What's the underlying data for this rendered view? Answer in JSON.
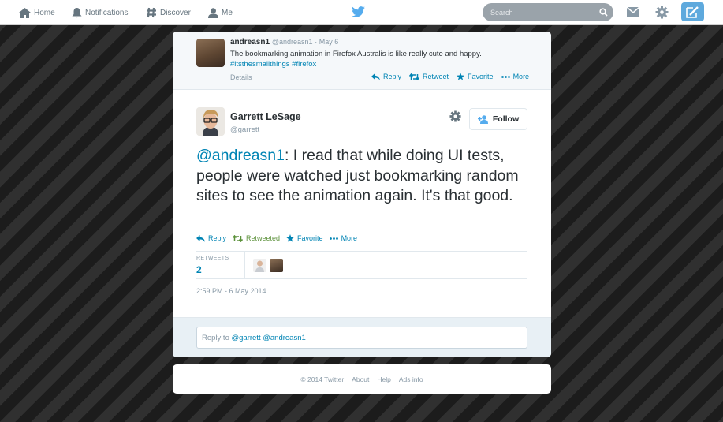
{
  "nav": {
    "home": "Home",
    "notifications": "Notifications",
    "discover": "Discover",
    "me": "Me",
    "search_placeholder": "Search"
  },
  "colors": {
    "link": "#0084b4",
    "twitter_blue": "#55acee",
    "retweeted": "#5c913b",
    "text_muted": "#8899a6"
  },
  "ancestor_tweet": {
    "name": "andreasn1",
    "handle": "@andreasn1",
    "date": "· May 6",
    "text": "The bookmarking animation in Firefox Australis is like really cute and happy.",
    "hashtag_1": "#itsthesmallthings",
    "hashtag_2": "#firefox",
    "details": "Details",
    "actions": {
      "reply": "Reply",
      "retweet": "Retweet",
      "favorite": "Favorite",
      "more": "More"
    }
  },
  "tweet": {
    "name": "Garrett LeSage",
    "handle": "@garrett",
    "follow": "Follow",
    "mention": "@andreasn1",
    "text": ": I read that while doing UI tests, people were watched just bookmarking random sites to see the animation again. It's that good.",
    "actions": {
      "reply": "Reply",
      "retweeted": "Retweeted",
      "favorite": "Favorite",
      "more": "More"
    },
    "retweets_label": "RETWEETS",
    "retweets_count": "2",
    "timestamp": "2:59 PM - 6 May 2014"
  },
  "reply": {
    "prefix": "Reply to ",
    "mentions": "@garrett @andreasn1"
  },
  "footer": {
    "copyright": "© 2014 Twitter",
    "about": "About",
    "help": "Help",
    "ads": "Ads info"
  }
}
